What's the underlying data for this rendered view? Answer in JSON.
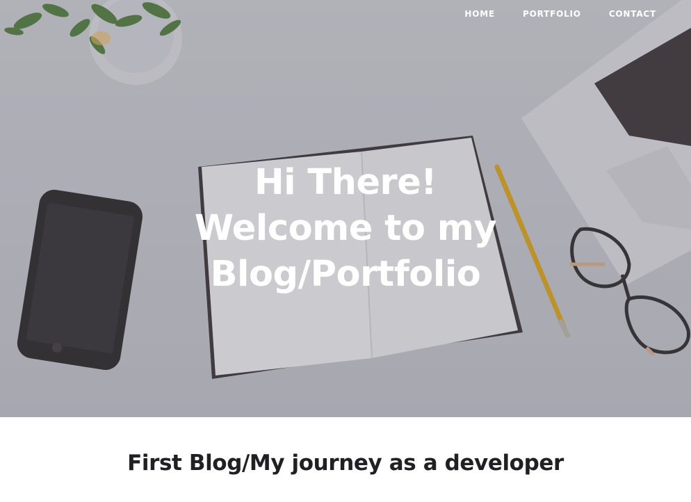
{
  "nav": {
    "items": [
      {
        "label": "HOME"
      },
      {
        "label": "PORTFOLIO"
      },
      {
        "label": "CONTACT"
      }
    ]
  },
  "hero": {
    "lines": [
      "Hi There!",
      "Welcome to my",
      "Blog/Portfolio"
    ]
  },
  "blog": {
    "first_post_title": "First Blog/My journey as a developer"
  },
  "colors": {
    "hero_text": "#ffffff",
    "post_title": "#1f1f24",
    "page_background": "#ffffff"
  }
}
